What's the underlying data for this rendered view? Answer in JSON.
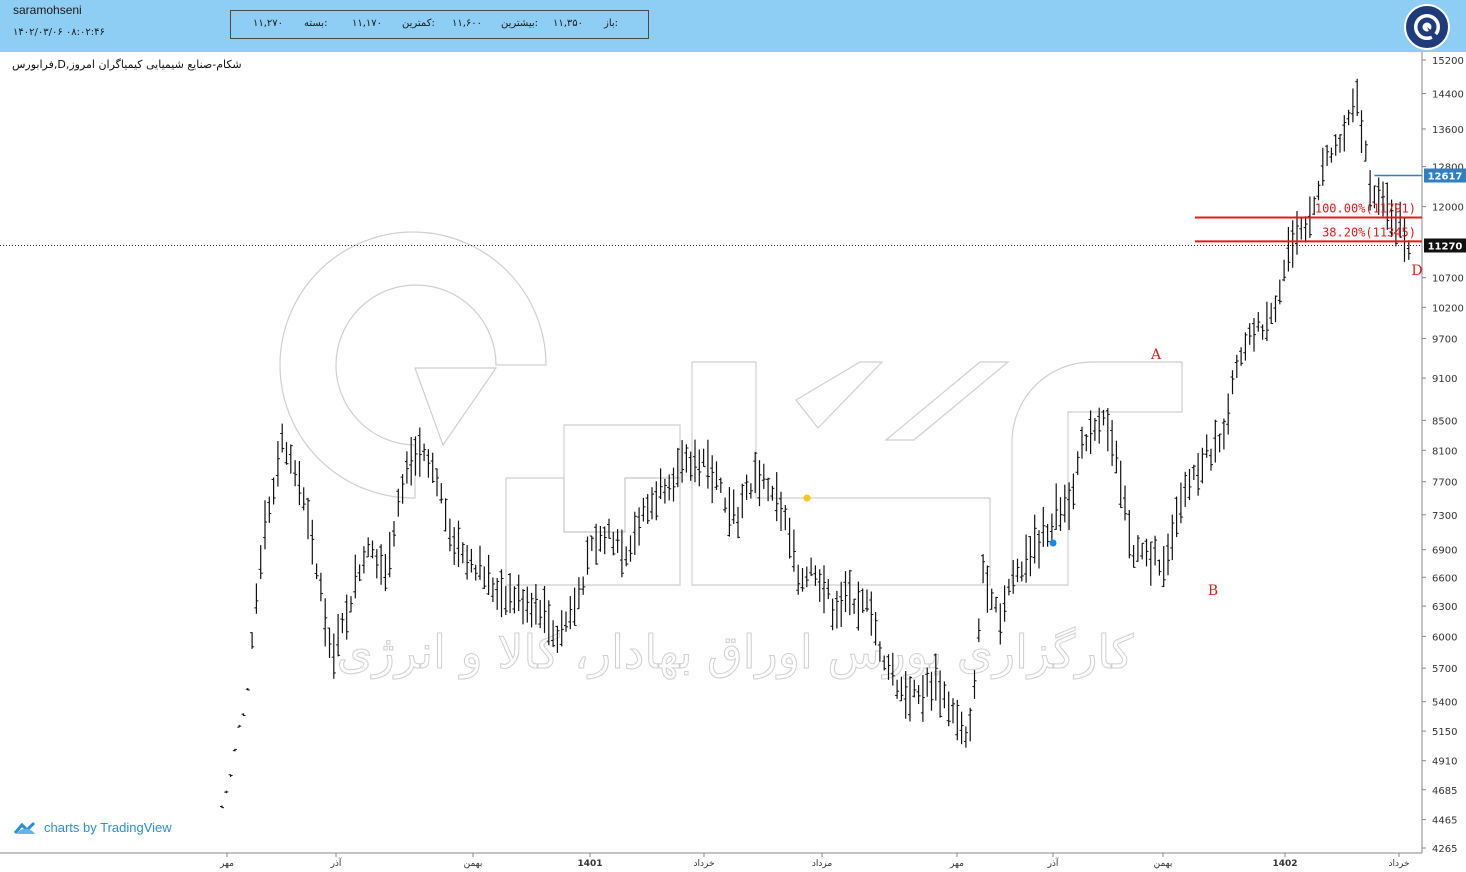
{
  "header": {
    "user": "saramohseni",
    "datetime": "۱۴۰۲/۰۳/۰۶ ۰۸:۰۲:۴۶",
    "ohlc": [
      {
        "label": "باز:",
        "value": "۱۱,۳۵۰"
      },
      {
        "label": "بیشترین:",
        "value": "۱۱,۶۰۰"
      },
      {
        "label": "کمترین:",
        "value": "۱۱,۱۷۰"
      },
      {
        "label": "بسته:",
        "value": "۱۱,۲۷۰"
      }
    ]
  },
  "symbol_title": "فرابورس,D,شکام-صنایع شیمیایی کیمیاگران امروز",
  "branding": {
    "tradingview": "charts by TradingView"
  },
  "watermark_text": "کارگزاری بورس اوراق بهادار، کالا و انرژی",
  "colors": {
    "topbar": "#8ecdf4",
    "fib_line": "#e01b1b",
    "last_price_bg": "#111111",
    "level_12617": "#2f7fc1",
    "accent": "#2a8dd6"
  },
  "chart_data": {
    "type": "ohlc",
    "y_scale": "log",
    "ylim": [
      4265,
      15200
    ],
    "y_ticks": [
      15200,
      14400,
      13600,
      12800,
      12000,
      11270,
      10700,
      10200,
      9700,
      9100,
      8500,
      8100,
      7700,
      7300,
      6900,
      6600,
      6300,
      6000,
      5700,
      5400,
      5150,
      4910,
      4685,
      4465,
      4265
    ],
    "x_ticks": [
      "مهر",
      "آذر",
      "بهمن",
      "1401",
      "خرداد",
      "مرداد",
      "مهر",
      "آذر",
      "بهمن",
      "1402",
      "خرداد"
    ],
    "last_price": {
      "value": 11270,
      "label": "11270"
    },
    "marker_level": {
      "value": 12617,
      "label": "12617"
    },
    "fib_levels": [
      {
        "label": "100.00%(11791)",
        "value": 11791
      },
      {
        "label": "38.20%(11345)",
        "value": 11345
      }
    ],
    "wave_labels": [
      "A",
      "B",
      "D"
    ],
    "anchors": [
      {
        "t": 0,
        "p": 4560
      },
      {
        "t": 6,
        "p": 5500
      },
      {
        "t": 10,
        "p": 7200
      },
      {
        "t": 14,
        "p": 8200
      },
      {
        "t": 18,
        "p": 7700
      },
      {
        "t": 22,
        "p": 6700
      },
      {
        "t": 26,
        "p": 5800
      },
      {
        "t": 30,
        "p": 6400
      },
      {
        "t": 34,
        "p": 7000
      },
      {
        "t": 38,
        "p": 6700
      },
      {
        "t": 42,
        "p": 7700
      },
      {
        "t": 46,
        "p": 8050
      },
      {
        "t": 50,
        "p": 7700
      },
      {
        "t": 54,
        "p": 7000
      },
      {
        "t": 58,
        "p": 6800
      },
      {
        "t": 63,
        "p": 6500
      },
      {
        "t": 68,
        "p": 6400
      },
      {
        "t": 74,
        "p": 6300
      },
      {
        "t": 78,
        "p": 6000
      },
      {
        "t": 82,
        "p": 6300
      },
      {
        "t": 86,
        "p": 6900
      },
      {
        "t": 90,
        "p": 7100
      },
      {
        "t": 94,
        "p": 6900
      },
      {
        "t": 98,
        "p": 7300
      },
      {
        "t": 103,
        "p": 7700
      },
      {
        "t": 108,
        "p": 7900
      },
      {
        "t": 112,
        "p": 8000
      },
      {
        "t": 116,
        "p": 7600
      },
      {
        "t": 120,
        "p": 7300
      },
      {
        "t": 124,
        "p": 7800
      },
      {
        "t": 128,
        "p": 7600
      },
      {
        "t": 131,
        "p": 7200
      },
      {
        "t": 134,
        "p": 6600
      },
      {
        "t": 138,
        "p": 6700
      },
      {
        "t": 142,
        "p": 6300
      },
      {
        "t": 146,
        "p": 6400
      },
      {
        "t": 150,
        "p": 6300
      },
      {
        "t": 154,
        "p": 5800
      },
      {
        "t": 158,
        "p": 5500
      },
      {
        "t": 162,
        "p": 5450
      },
      {
        "t": 166,
        "p": 5600
      },
      {
        "t": 170,
        "p": 5300
      },
      {
        "t": 173,
        "p": 5050
      },
      {
        "t": 175,
        "p": 5500
      },
      {
        "t": 177,
        "p": 6700
      },
      {
        "t": 181,
        "p": 6200
      },
      {
        "t": 185,
        "p": 6700
      },
      {
        "t": 190,
        "p": 7000
      },
      {
        "t": 194,
        "p": 7300
      },
      {
        "t": 197,
        "p": 7500
      },
      {
        "t": 201,
        "p": 8300
      },
      {
        "t": 205,
        "p": 8600
      },
      {
        "t": 208,
        "p": 7900
      },
      {
        "t": 212,
        "p": 6900
      },
      {
        "t": 216,
        "p": 6800
      },
      {
        "t": 220,
        "p": 6800
      },
      {
        "t": 224,
        "p": 7600
      },
      {
        "t": 228,
        "p": 8000
      },
      {
        "t": 232,
        "p": 8200
      },
      {
        "t": 236,
        "p": 9200
      },
      {
        "t": 240,
        "p": 9800
      },
      {
        "t": 244,
        "p": 10000
      },
      {
        "t": 248,
        "p": 11200
      },
      {
        "t": 252,
        "p": 11500
      },
      {
        "t": 256,
        "p": 12800
      },
      {
        "t": 260,
        "p": 13300
      },
      {
        "t": 264,
        "p": 14200
      },
      {
        "t": 267,
        "p": 12500
      },
      {
        "t": 270,
        "p": 12000
      },
      {
        "t": 273,
        "p": 11800
      },
      {
        "t": 276,
        "p": 11270
      }
    ]
  }
}
